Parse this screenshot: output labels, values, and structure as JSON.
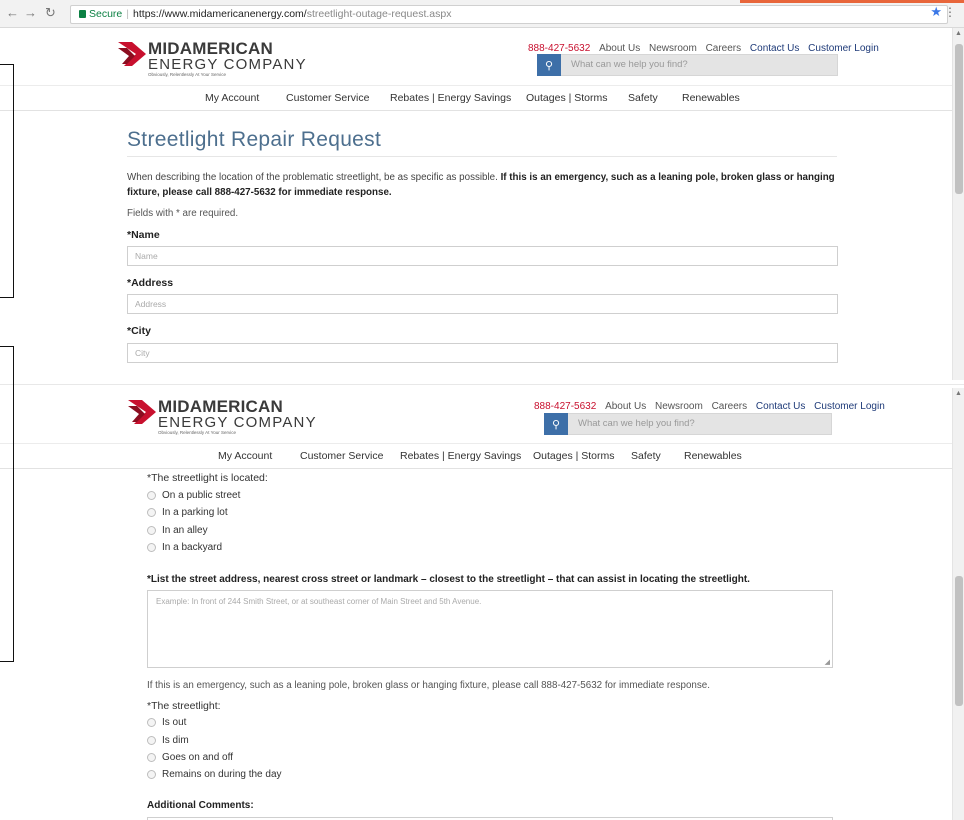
{
  "browser": {
    "secure_label": "Secure",
    "url_host": "https://www.midamericanenergy.com/",
    "url_path": "streetlight-outage-request.aspx"
  },
  "header": {
    "logo": {
      "line1": "MIDAMERICAN",
      "line2": "ENERGY COMPANY",
      "tagline": "Obviously, Relentlessly At Your Service"
    },
    "phone": "888-427-5632",
    "links": [
      "About Us",
      "Newsroom",
      "Careers",
      "Contact Us",
      "Customer Login"
    ],
    "search_placeholder": "What can we help you find?"
  },
  "nav": [
    "My Account",
    "Customer Service",
    "Rebates | Energy Savings",
    "Outages | Storms",
    "Safety",
    "Renewables"
  ],
  "form_top": {
    "title": "Streetlight Repair Request",
    "intro_plain": "When describing the location of the problematic streetlight, be as specific as possible. ",
    "intro_bold": "If this is an emergency, such as a leaning pole, broken glass or hanging fixture, please call 888-427-5632 for immediate response.",
    "required_note": "Fields with * are required.",
    "fields": [
      {
        "label": "*Name",
        "placeholder": "Name"
      },
      {
        "label": "*Address",
        "placeholder": "Address"
      },
      {
        "label": "*City",
        "placeholder": "City"
      }
    ]
  },
  "form_bottom": {
    "location_question": "*The streetlight is located:",
    "location_options": [
      "On a public street",
      "In a parking lot",
      "In an alley",
      "In a backyard"
    ],
    "landmark_label": "*List the street address, nearest cross street or landmark – closest to the streetlight – that can assist in locating the streetlight.",
    "landmark_placeholder": "Example: In front of 244 Smith Street, or at southeast corner of Main Street and 5th Avenue.",
    "emergency_note": "If this is an emergency, such as a leaning pole, broken glass or hanging fixture, please call 888-427-5632 for immediate response.",
    "status_question": "*The streetlight:",
    "status_options": [
      "Is out",
      "Is dim",
      "Goes on and off",
      "Remains on during the day"
    ],
    "comments_label": "Additional Comments:"
  },
  "colors": {
    "brand_red": "#c8102e",
    "title_blue": "#4d6f8e",
    "search_button": "#3d6fa8",
    "link_dark": "#1e3a78"
  }
}
